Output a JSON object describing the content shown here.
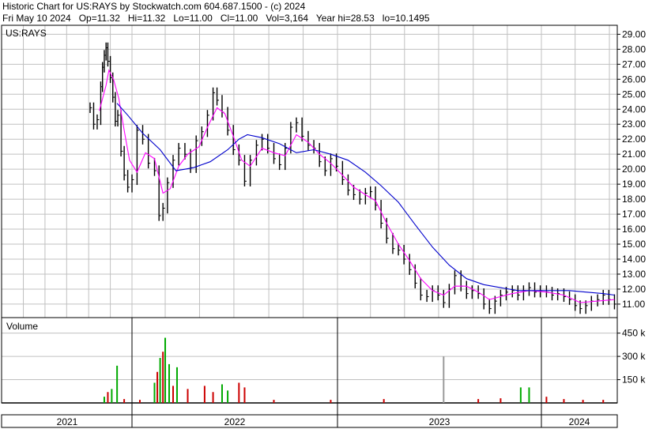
{
  "header": {
    "title_line": "Historic Chart for US:RAYS by Stockwatch.com 604.687.1500 - (c) 2024",
    "quote_line": "Fri May 10 2024   Op=11.32   Hi=11.32   Lo=11.00   Cl=11.00   Vol=3,164   Year hi=28.53   lo=10.1495"
  },
  "colors": {
    "price_bar": "#000000",
    "ma_short": "#ff00ff",
    "ma_long": "#0000cc",
    "volume_up": "#00aa00",
    "volume_down": "#cc0000",
    "volume_neutral": "#999999",
    "grid": "#c0c0c0"
  },
  "chart_data": [
    {
      "type": "line",
      "panel_label": "US:RAYS",
      "grid": true,
      "y_axis_position": "right",
      "ylim": [
        10.1,
        29.6
      ],
      "y_ticks": [
        11,
        12,
        13,
        14,
        15,
        16,
        17,
        18,
        19,
        20,
        21,
        22,
        23,
        24,
        25,
        26,
        27,
        28,
        29
      ],
      "y_tick_labels": [
        "11.00",
        "12.00",
        "13.00",
        "14.00",
        "15.00",
        "16.00",
        "17.00",
        "18.00",
        "19.00",
        "20.00",
        "21.00",
        "22.00",
        "23.00",
        "24.00",
        "25.00",
        "26.00",
        "27.00",
        "28.00",
        "29.00"
      ],
      "x_labels": [
        "2021",
        "2022",
        "2023",
        "2024"
      ],
      "x_range": [
        "2021-09",
        "2024-05"
      ],
      "series": [
        {
          "style": "price_bars",
          "points": [
            [
              "2021-09-05",
              24.1
            ],
            [
              "2021-09-15",
              23.0
            ],
            [
              "2021-09-25",
              23.3
            ],
            [
              "2021-10-05",
              25.5
            ],
            [
              "2021-10-10",
              26.8
            ],
            [
              "2021-10-15",
              27.6
            ],
            [
              "2021-10-20",
              28.1
            ],
            [
              "2021-10-25",
              27.2
            ],
            [
              "2021-11-01",
              26.1
            ],
            [
              "2021-11-08",
              24.8
            ],
            [
              "2021-11-15",
              23.2
            ],
            [
              "2021-11-22",
              23.6
            ],
            [
              "2021-12-01",
              21.2
            ],
            [
              "2021-12-10",
              19.6
            ],
            [
              "2021-12-20",
              18.8
            ],
            [
              "2022-01-01",
              19.3
            ],
            [
              "2022-01-10",
              22.6
            ],
            [
              "2022-01-20",
              22.0
            ],
            [
              "2022-01-30",
              20.4
            ],
            [
              "2022-02-10",
              19.9
            ],
            [
              "2022-02-18",
              16.9
            ],
            [
              "2022-02-25",
              17.4
            ],
            [
              "2022-03-05",
              19.1
            ],
            [
              "2022-03-15",
              20.6
            ],
            [
              "2022-03-25",
              21.4
            ],
            [
              "2022-04-05",
              21.0
            ],
            [
              "2022-04-15",
              20.1
            ],
            [
              "2022-04-25",
              21.9
            ],
            [
              "2022-05-05",
              22.5
            ],
            [
              "2022-05-15",
              23.6
            ],
            [
              "2022-05-25",
              25.1
            ],
            [
              "2022-06-01",
              24.6
            ],
            [
              "2022-06-10",
              23.8
            ],
            [
              "2022-06-20",
              22.6
            ],
            [
              "2022-06-30",
              21.3
            ],
            [
              "2022-07-10",
              20.6
            ],
            [
              "2022-07-20",
              19.2
            ],
            [
              "2022-07-30",
              20.6
            ],
            [
              "2022-08-10",
              21.6
            ],
            [
              "2022-08-20",
              22.0
            ],
            [
              "2022-08-30",
              21.4
            ],
            [
              "2022-09-10",
              20.7
            ],
            [
              "2022-09-20",
              20.3
            ],
            [
              "2022-09-30",
              21.4
            ],
            [
              "2022-10-10",
              22.8
            ],
            [
              "2022-10-20",
              23.1
            ],
            [
              "2022-10-30",
              22.2
            ],
            [
              "2022-11-10",
              21.6
            ],
            [
              "2022-11-20",
              21.4
            ],
            [
              "2022-11-30",
              20.5
            ],
            [
              "2022-12-10",
              19.9
            ],
            [
              "2022-12-20",
              20.7
            ],
            [
              "2022-12-30",
              20.2
            ],
            [
              "2023-01-10",
              19.3
            ],
            [
              "2023-01-20",
              18.6
            ],
            [
              "2023-01-30",
              18.3
            ],
            [
              "2023-02-10",
              18.0
            ],
            [
              "2023-02-20",
              18.4
            ],
            [
              "2023-03-01",
              18.5
            ],
            [
              "2023-03-10",
              17.6
            ],
            [
              "2023-03-20",
              16.4
            ],
            [
              "2023-03-30",
              15.4
            ],
            [
              "2023-04-10",
              14.7
            ],
            [
              "2023-04-20",
              14.6
            ],
            [
              "2023-04-30",
              14.0
            ],
            [
              "2023-05-10",
              13.3
            ],
            [
              "2023-05-20",
              12.4
            ],
            [
              "2023-05-30",
              11.6
            ],
            [
              "2023-06-10",
              11.5
            ],
            [
              "2023-06-20",
              11.9
            ],
            [
              "2023-06-30",
              11.6
            ],
            [
              "2023-07-10",
              11.1
            ],
            [
              "2023-07-20",
              12.0
            ],
            [
              "2023-07-30",
              12.9
            ],
            [
              "2023-08-10",
              12.2
            ],
            [
              "2023-08-20",
              11.7
            ],
            [
              "2023-08-30",
              11.9
            ],
            [
              "2023-09-10",
              11.7
            ],
            [
              "2023-09-20",
              11.0
            ],
            [
              "2023-09-30",
              10.7
            ],
            [
              "2023-10-10",
              11.2
            ],
            [
              "2023-10-20",
              11.6
            ],
            [
              "2023-10-30",
              11.8
            ],
            [
              "2023-11-10",
              11.9
            ],
            [
              "2023-11-20",
              11.6
            ],
            [
              "2023-11-30",
              11.9
            ],
            [
              "2023-12-10",
              12.1
            ],
            [
              "2023-12-20",
              11.8
            ],
            [
              "2023-12-30",
              11.9
            ],
            [
              "2024-01-10",
              11.8
            ],
            [
              "2024-01-20",
              11.6
            ],
            [
              "2024-01-30",
              11.7
            ],
            [
              "2024-02-10",
              11.5
            ],
            [
              "2024-02-20",
              11.3
            ],
            [
              "2024-03-01",
              10.9
            ],
            [
              "2024-03-10",
              10.7
            ],
            [
              "2024-03-20",
              10.9
            ],
            [
              "2024-03-30",
              11.2
            ],
            [
              "2024-04-10",
              11.3
            ],
            [
              "2024-04-20",
              11.6
            ],
            [
              "2024-04-30",
              11.3
            ],
            [
              "2024-05-10",
              11.0
            ]
          ]
        },
        {
          "style": "ma_short",
          "points": [
            [
              "2021-10-01",
              23.9
            ],
            [
              "2021-10-20",
              25.6
            ],
            [
              "2021-10-28",
              26.6
            ],
            [
              "2021-11-10",
              26.0
            ],
            [
              "2021-11-25",
              24.7
            ],
            [
              "2021-12-10",
              22.6
            ],
            [
              "2021-12-25",
              20.6
            ],
            [
              "2022-01-10",
              19.8
            ],
            [
              "2022-01-25",
              21.1
            ],
            [
              "2022-02-10",
              20.7
            ],
            [
              "2022-02-25",
              18.4
            ],
            [
              "2022-03-10",
              18.7
            ],
            [
              "2022-03-25",
              20.2
            ],
            [
              "2022-04-10",
              21.0
            ],
            [
              "2022-04-30",
              21.5
            ],
            [
              "2022-05-15",
              22.8
            ],
            [
              "2022-06-01",
              24.1
            ],
            [
              "2022-06-15",
              23.7
            ],
            [
              "2022-07-01",
              22.1
            ],
            [
              "2022-07-15",
              20.6
            ],
            [
              "2022-07-30",
              20.2
            ],
            [
              "2022-08-20",
              21.4
            ],
            [
              "2022-09-10",
              21.1
            ],
            [
              "2022-09-30",
              20.9
            ],
            [
              "2022-10-20",
              22.3
            ],
            [
              "2022-11-10",
              21.8
            ],
            [
              "2022-11-30",
              21.0
            ],
            [
              "2022-12-20",
              20.4
            ],
            [
              "2023-01-10",
              19.6
            ],
            [
              "2023-01-30",
              18.8
            ],
            [
              "2023-02-20",
              18.3
            ],
            [
              "2023-03-10",
              17.9
            ],
            [
              "2023-03-30",
              16.4
            ],
            [
              "2023-04-20",
              15.0
            ],
            [
              "2023-05-10",
              13.9
            ],
            [
              "2023-05-30",
              12.7
            ],
            [
              "2023-06-20",
              11.9
            ],
            [
              "2023-07-10",
              11.6
            ],
            [
              "2023-07-30",
              12.2
            ],
            [
              "2023-08-20",
              12.2
            ],
            [
              "2023-09-10",
              11.8
            ],
            [
              "2023-09-30",
              11.3
            ],
            [
              "2023-10-20",
              11.5
            ],
            [
              "2023-11-10",
              11.7
            ],
            [
              "2023-12-10",
              11.9
            ],
            [
              "2024-01-10",
              11.8
            ],
            [
              "2024-02-10",
              11.6
            ],
            [
              "2024-03-10",
              11.1
            ],
            [
              "2024-04-10",
              11.2
            ],
            [
              "2024-05-10",
              11.3
            ]
          ]
        },
        {
          "style": "ma_long",
          "points": [
            [
              "2021-11-20",
              24.4
            ],
            [
              "2021-12-20",
              23.6
            ],
            [
              "2022-01-20",
              22.4
            ],
            [
              "2022-02-20",
              21.3
            ],
            [
              "2022-03-20",
              19.9
            ],
            [
              "2022-04-20",
              20.1
            ],
            [
              "2022-05-20",
              20.5
            ],
            [
              "2022-06-20",
              21.3
            ],
            [
              "2022-07-10",
              22.0
            ],
            [
              "2022-07-25",
              22.3
            ],
            [
              "2022-08-20",
              22.1
            ],
            [
              "2022-09-20",
              21.7
            ],
            [
              "2022-10-20",
              21.1
            ],
            [
              "2022-11-20",
              21.3
            ],
            [
              "2022-12-20",
              21.0
            ],
            [
              "2023-01-20",
              20.6
            ],
            [
              "2023-02-20",
              19.8
            ],
            [
              "2023-03-20",
              18.9
            ],
            [
              "2023-04-20",
              17.8
            ],
            [
              "2023-05-20",
              16.3
            ],
            [
              "2023-06-20",
              14.8
            ],
            [
              "2023-07-20",
              13.6
            ],
            [
              "2023-08-20",
              12.7
            ],
            [
              "2023-09-20",
              12.3
            ],
            [
              "2023-10-20",
              12.1
            ],
            [
              "2023-11-20",
              11.9
            ],
            [
              "2023-12-20",
              11.9
            ],
            [
              "2024-01-20",
              11.9
            ],
            [
              "2024-02-20",
              11.9
            ],
            [
              "2024-03-20",
              11.8
            ],
            [
              "2024-04-20",
              11.7
            ],
            [
              "2024-05-10",
              11.6
            ]
          ]
        }
      ]
    },
    {
      "type": "bar",
      "panel_label": "Volume",
      "ylim": [
        0,
        550000
      ],
      "y_ticks": [
        150000,
        300000,
        450000
      ],
      "y_tick_labels": [
        "150 k",
        "300 k",
        "450 k"
      ],
      "bars": [
        [
          "2021-10-15",
          40000,
          "up"
        ],
        [
          "2021-10-25",
          70000,
          "down"
        ],
        [
          "2021-11-05",
          90000,
          "up"
        ],
        [
          "2021-11-20",
          240000,
          "up"
        ],
        [
          "2021-12-10",
          25000,
          "down"
        ],
        [
          "2022-01-15",
          20000,
          "down"
        ],
        [
          "2022-02-10",
          130000,
          "up"
        ],
        [
          "2022-02-15",
          200000,
          "down"
        ],
        [
          "2022-02-20",
          290000,
          "up"
        ],
        [
          "2022-02-25",
          330000,
          "down"
        ],
        [
          "2022-03-01",
          420000,
          "up"
        ],
        [
          "2022-03-08",
          250000,
          "up"
        ],
        [
          "2022-03-15",
          110000,
          "down"
        ],
        [
          "2022-03-22",
          230000,
          "up"
        ],
        [
          "2022-04-10",
          90000,
          "down"
        ],
        [
          "2022-05-10",
          110000,
          "down"
        ],
        [
          "2022-05-25",
          70000,
          "down"
        ],
        [
          "2022-06-10",
          120000,
          "up"
        ],
        [
          "2022-06-20",
          80000,
          "up"
        ],
        [
          "2022-07-10",
          130000,
          "down"
        ],
        [
          "2022-07-20",
          100000,
          "down"
        ],
        [
          "2022-09-10",
          20000,
          "down"
        ],
        [
          "2022-12-20",
          20000,
          "down"
        ],
        [
          "2023-03-25",
          25000,
          "down"
        ],
        [
          "2023-07-10",
          300000,
          "neutral"
        ],
        [
          "2023-09-10",
          25000,
          "down"
        ],
        [
          "2023-10-20",
          30000,
          "down"
        ],
        [
          "2023-11-25",
          100000,
          "up"
        ],
        [
          "2023-12-10",
          100000,
          "up"
        ],
        [
          "2024-01-10",
          40000,
          "down"
        ],
        [
          "2024-02-10",
          25000,
          "down"
        ],
        [
          "2024-03-15",
          20000,
          "down"
        ],
        [
          "2024-04-20",
          20000,
          "down"
        ]
      ]
    }
  ]
}
